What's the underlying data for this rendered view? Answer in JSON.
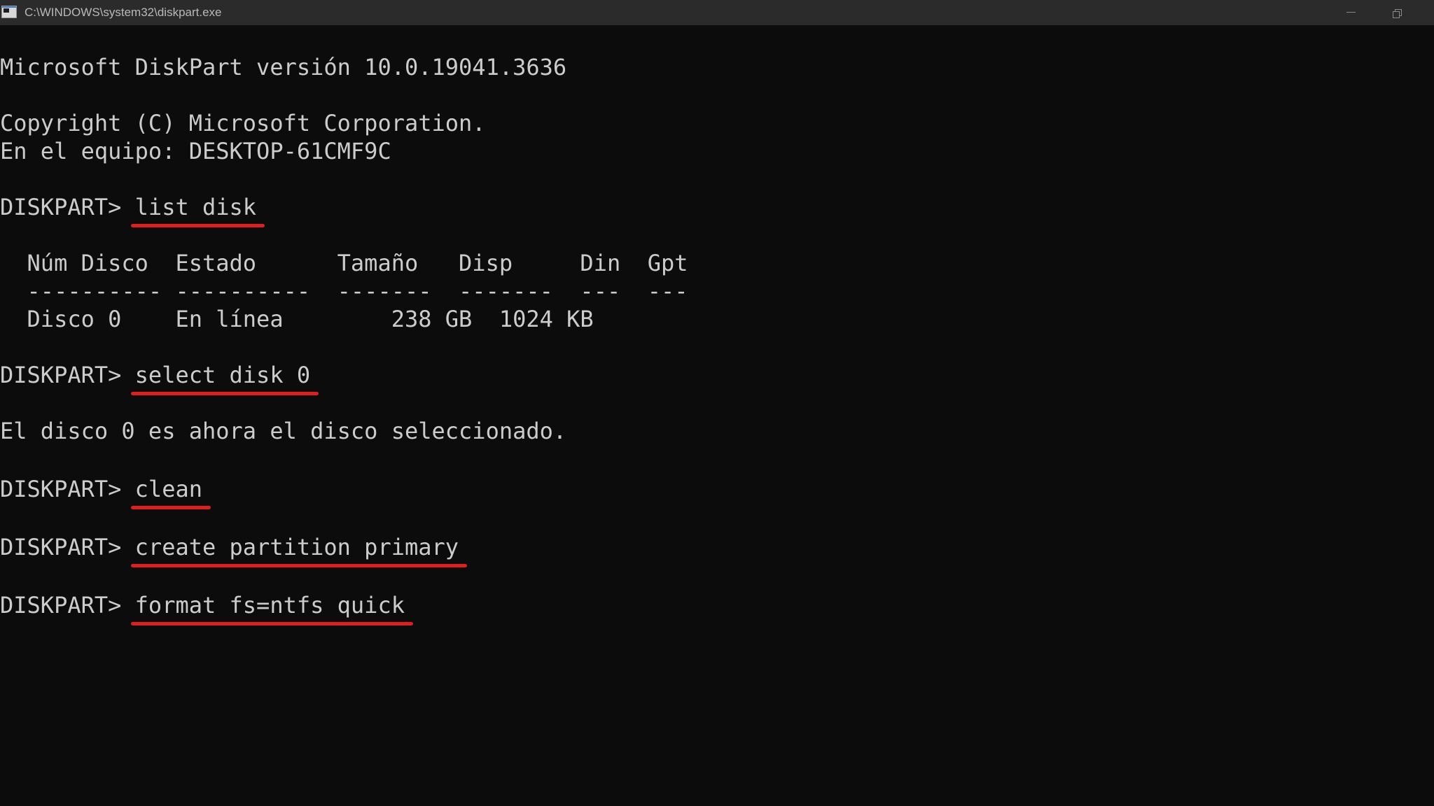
{
  "window": {
    "title": "C:\\WINDOWS\\system32\\diskpart.exe"
  },
  "console": {
    "header": {
      "version": "Microsoft DiskPart versión 10.0.19041.3636",
      "copyright": "Copyright (C) Microsoft Corporation.",
      "computer": "En el equipo: DESKTOP-61CMF9C"
    },
    "prompt": "DISKPART> ",
    "commands": {
      "list_disk": "list disk",
      "select_disk": "select disk 0",
      "clean": "clean",
      "create_partition": "create partition primary",
      "format": "format fs=ntfs quick"
    },
    "disk_table": {
      "header": "  Núm Disco  Estado      Tamaño   Disp     Din  Gpt",
      "separator": "  ---------- ----------  -------  -------  ---  ---",
      "rows": [
        "  Disco 0    En línea        238 GB  1024 KB"
      ]
    },
    "messages": {
      "select_result": "El disco 0 es ahora el disco seleccionado."
    }
  }
}
